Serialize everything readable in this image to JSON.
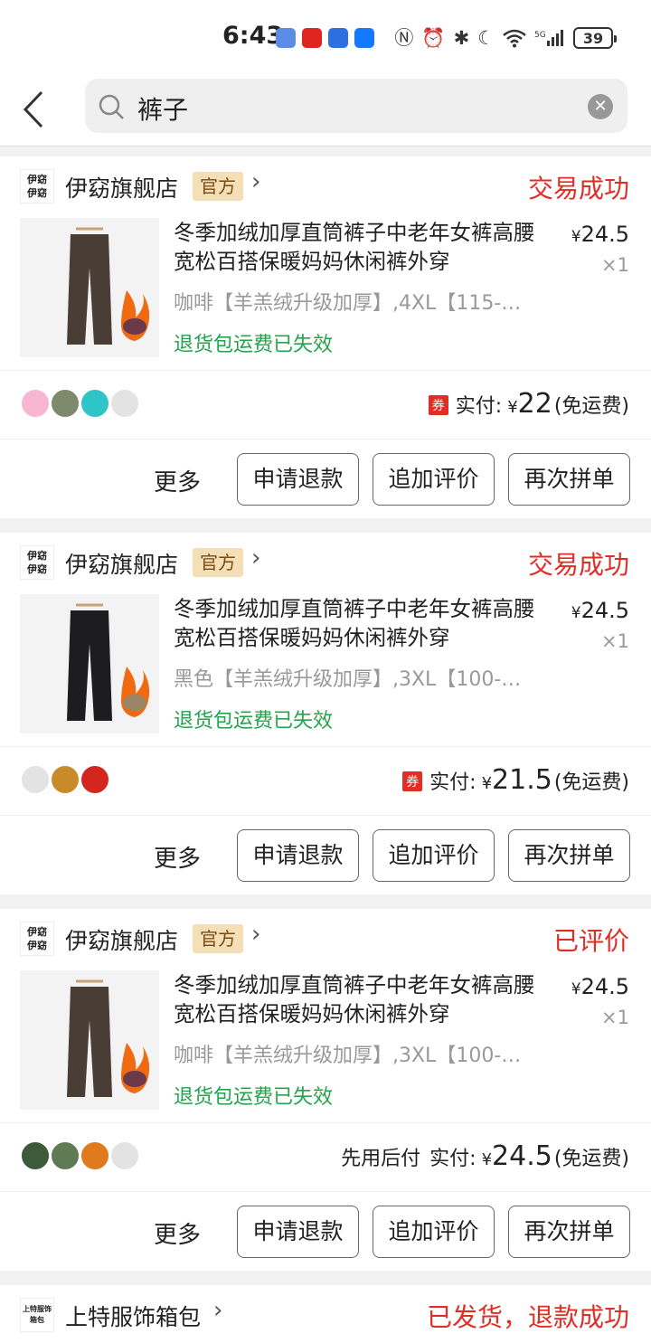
{
  "status_bar": {
    "time": "6:43",
    "battery": "39"
  },
  "search": {
    "query": "裤子"
  },
  "actions": {
    "more": "更多",
    "refund": "申请退款",
    "add_review": "追加评价",
    "rebuy": "再次拼单"
  },
  "orders": [
    {
      "shop_logo_text": "伊窈\n伊窈",
      "shop_name": "伊窈旗舰店",
      "badge": "官方",
      "status": "交易成功",
      "title": "冬季加绒加厚直筒裤子中老年女裤高腰宽松百搭保暖妈妈休闲裤外穿",
      "price": "24.5",
      "qty": "×1",
      "spec": "咖啡【羊羔绒升级加厚】,4XL【115-…",
      "refund_tip": "退货包运费已失效",
      "paid_label": "实付:",
      "paid_amount": "22",
      "shipping": "(免运费)",
      "coupon": "券",
      "pants_color": "#4a3d36"
    },
    {
      "shop_logo_text": "伊窈\n伊窈",
      "shop_name": "伊窈旗舰店",
      "badge": "官方",
      "status": "交易成功",
      "title": "冬季加绒加厚直筒裤子中老年女裤高腰宽松百搭保暖妈妈休闲裤外穿",
      "price": "24.5",
      "qty": "×1",
      "spec": "黑色【羊羔绒升级加厚】,3XL【100-…",
      "refund_tip": "退货包运费已失效",
      "paid_label": "实付:",
      "paid_amount": "21.5",
      "shipping": "(免运费)",
      "coupon": "券",
      "pants_color": "#1d1d1f"
    },
    {
      "shop_logo_text": "伊窈\n伊窈",
      "shop_name": "伊窈旗舰店",
      "badge": "官方",
      "status": "已评价",
      "title": "冬季加绒加厚直筒裤子中老年女裤高腰宽松百搭保暖妈妈休闲裤外穿",
      "price": "24.5",
      "qty": "×1",
      "spec": "咖啡【羊羔绒升级加厚】,3XL【100-…",
      "refund_tip": "退货包运费已失效",
      "pay_later": "先用后付",
      "paid_label": "实付:",
      "paid_amount": "24.5",
      "shipping": "(免运费)",
      "pants_color": "#4a3d36"
    },
    {
      "shop_logo_text": "上特服饰\n箱包",
      "shop_name": "上特服饰箱包",
      "status": "已发货，退款成功"
    }
  ],
  "colors": {
    "accent_red": "#e02e24",
    "green": "#25a24a",
    "badge_bg": "#f5dfb6"
  }
}
